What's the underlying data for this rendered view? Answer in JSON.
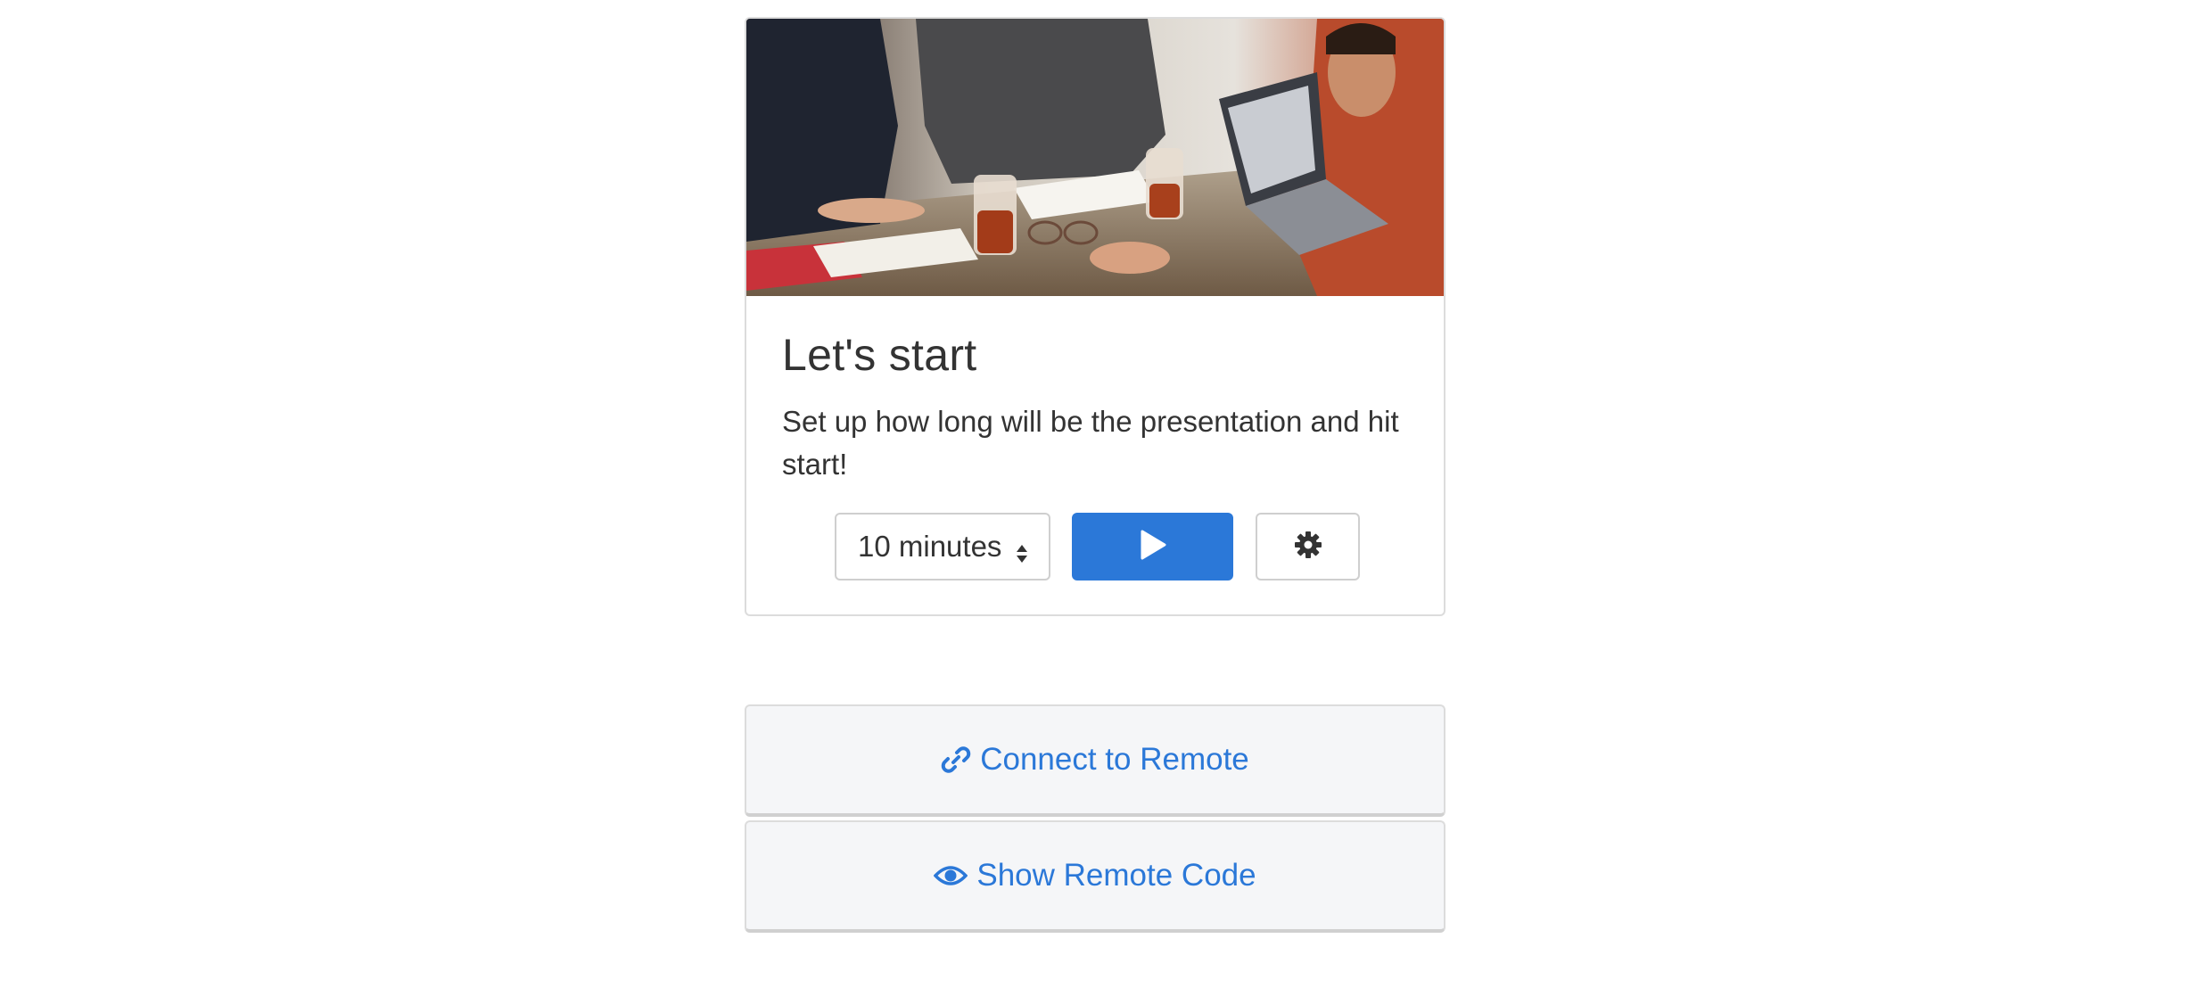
{
  "card": {
    "image_alt": "people working at a table with laptop and drinks",
    "title": "Let's start",
    "description": "Set up how long will be the presentation and hit start!"
  },
  "controls": {
    "duration": {
      "selected": "10 minutes",
      "icon": "sort-caret-icon"
    },
    "play_icon": "play-icon",
    "settings_icon": "gear-icon"
  },
  "remote": {
    "connect_label": "Connect to Remote",
    "connect_icon": "link-icon",
    "show_code_label": "Show Remote Code",
    "show_code_icon": "eye-icon"
  },
  "colors": {
    "accent": "#2b78d8",
    "text": "#333333",
    "border": "#dcdcdc",
    "button_bg": "#f5f6f8"
  }
}
